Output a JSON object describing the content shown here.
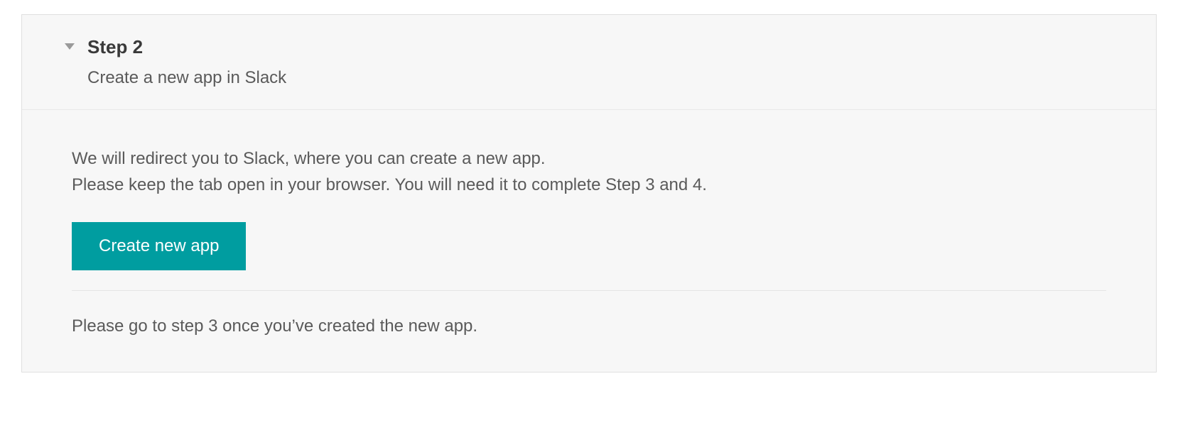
{
  "step": {
    "title": "Step 2",
    "subtitle": "Create a new app in Slack",
    "body": {
      "line1": "We will redirect you to Slack, where you can create a new app.",
      "line2": "Please keep the tab open in your browser. You will need it to complete Step 3 and 4.",
      "button_label": "Create new app",
      "footer": "Please go to step 3 once you’ve created the new app."
    }
  }
}
